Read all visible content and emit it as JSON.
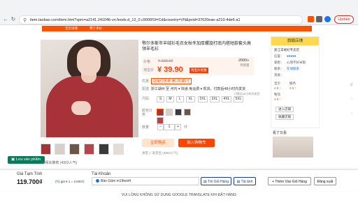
{
  "browser": {
    "url": "item.taobao.com/item.htm?spm=a2141.241046-vn.feeds.d_12_0.c9006f1f=Cd&country=VN&pvid=37620eae-a210-4de6-a156-4490fc757fb5&id=665…",
    "update_label": "Update"
  },
  "nav_strip": [
    "宝贝详情",
    "累计评价"
  ],
  "product": {
    "title": "鄂尔多斯市羊绒衫毛衣女秋冬加厚螺旋打底内搭短款套头高领羊毛衫",
    "price_label": "价格",
    "old_price": "¥ 298.00",
    "discount_label": "淘宝价",
    "new_price": "¥ 39.90",
    "promo_badge": "淘宝价优惠",
    "sales_count": "2000+",
    "sales_label": "月销量",
    "coupon_label": "优惠",
    "coupon_value": "店铺优惠券 满199减5元",
    "ship_label": "配送",
    "ship_value": "浙江湖州 至 河内 ▾ 快递 免运费 ▾  现货，付款后48小时内发货",
    "ship_note": "付款后48小时内发货",
    "size_label": "尺码",
    "sizes": [
      "S",
      "M",
      "L",
      "XL",
      "2XL",
      "3XL",
      "4XL",
      "5XL"
    ],
    "color_label": "颜色分类",
    "qty_label": "数量",
    "qty_value": "1",
    "qty_unit": "件",
    "buy_label": "立即购买",
    "cart_label": "加入购物车",
    "promise": "承诺 ✓ 退货宝 (4903人气)"
  },
  "shop": {
    "header": "旗舰店铺",
    "name": "浙江羊绒衫专卖店",
    "rating_label": "信誉：",
    "rating_stars": "♥♥♥♥♥",
    "desc_label": "掌柜：",
    "desc_value": "心领不好米银",
    "contact_label": "联系：",
    "contact_value": "在线联系",
    "qual_label": "资质：",
    "score_labels": [
      "宝贝",
      "服务",
      "物流"
    ],
    "score_values": [
      "4.8 ↑",
      "4.8 ↑",
      "4.8 ↑"
    ],
    "enter_shop": "进入店铺",
    "fav_shop": "收藏店铺",
    "recommend": "看了又看"
  },
  "save_button": "Lưu sản phẩm",
  "linked_note": "⊕ 相关推荐 (4903人气)",
  "extension": {
    "total_label": "Giá Tạm Tính",
    "total_value": "119.700₫",
    "rate": "(Tỷ giá ¥ 1 = 3.000₫)",
    "account_label": "Tài Khoản",
    "account_value": "Bảo Gấm     m19test4",
    "cart_btn": "Tới Giỏ Hàng",
    "pay_btn": "Tải ảnh",
    "add_btn": "+ Thêm Vào Giỏ Hàng",
    "login_btn": "Đăng xuất",
    "footer": "VUI LÒNG KHÔNG SỬ DỤNG GOOGLE TRANSLATE KHI ĐẶT HÀNG"
  },
  "colors": {
    "orange": "#ff5000",
    "brand_blue": "#1a3c8c",
    "save_green": "#0b7a5a"
  }
}
